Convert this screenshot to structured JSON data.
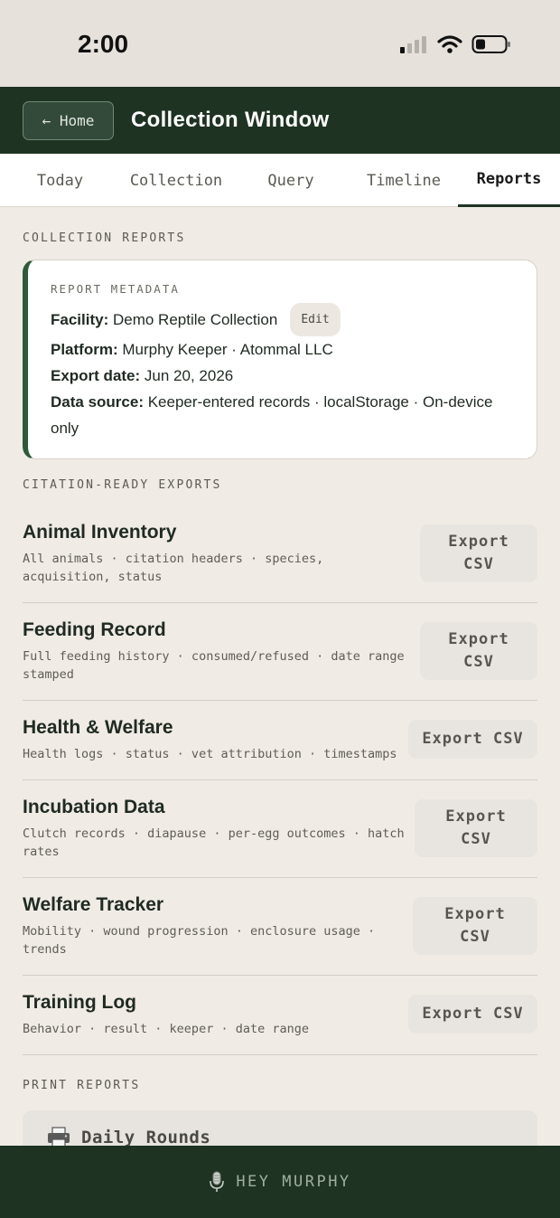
{
  "status": {
    "time": "2:00"
  },
  "header": {
    "home_label": "← Home",
    "title": "Collection Window"
  },
  "tabs": [
    {
      "label": "Today"
    },
    {
      "label": "Collection"
    },
    {
      "label": "Query"
    },
    {
      "label": "Timeline"
    },
    {
      "label": "Reports",
      "active": true
    }
  ],
  "sections": {
    "collection_reports": "COLLECTION REPORTS",
    "citation_exports": "CITATION-READY EXPORTS",
    "print_reports": "PRINT REPORTS"
  },
  "metadata": {
    "label": "REPORT METADATA",
    "facility_key": "Facility:",
    "facility_value": "Demo Reptile Collection",
    "edit_label": "Edit",
    "platform_key": "Platform:",
    "platform_value": "Murphy Keeper · Atommal LLC",
    "export_date_key": "Export date:",
    "export_date_value": "Jun 20, 2026",
    "data_source_key": "Data source:",
    "data_source_value": "Keeper-entered records · localStorage · On-device only"
  },
  "exports": [
    {
      "title": "Animal Inventory",
      "desc": "All animals · citation headers · species, acquisition, status",
      "button": "Export CSV"
    },
    {
      "title": "Feeding Record",
      "desc": "Full feeding history · consumed/refused · date range stamped",
      "button": "Export CSV"
    },
    {
      "title": "Health & Welfare",
      "desc": "Health logs · status · vet attribution · timestamps",
      "button": "Export CSV"
    },
    {
      "title": "Incubation Data",
      "desc": "Clutch records · diapause · per-egg outcomes · hatch rates",
      "button": "Export CSV"
    },
    {
      "title": "Welfare Tracker",
      "desc": "Mobility · wound progression · enclosure usage · trends",
      "button": "Export CSV"
    },
    {
      "title": "Training Log",
      "desc": "Behavior · result · keeper · date range",
      "button": "Export CSV"
    }
  ],
  "print": {
    "daily_rounds": "Daily Rounds"
  },
  "bottom": {
    "label": "HEY MURPHY"
  },
  "colors": {
    "header_bg": "#1e3322",
    "accent": "#2d5a3a",
    "page_bg": "#f0ebe5"
  }
}
